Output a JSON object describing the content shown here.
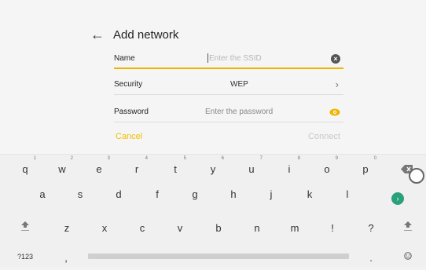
{
  "header": {
    "title": "Add network"
  },
  "form": {
    "name": {
      "label": "Name",
      "placeholder": "Enter the SSID"
    },
    "security": {
      "label": "Security",
      "value": "WEP"
    },
    "password": {
      "label": "Password",
      "placeholder": "Enter the password"
    },
    "cancel_label": "Cancel",
    "connect_label": "Connect"
  },
  "colors": {
    "accent": "#f0b400",
    "enter": "#2aa17a"
  },
  "keyboard": {
    "row1": [
      {
        "k": "q",
        "h": "1"
      },
      {
        "k": "w",
        "h": "2"
      },
      {
        "k": "e",
        "h": "3"
      },
      {
        "k": "r",
        "h": "4"
      },
      {
        "k": "t",
        "h": "5"
      },
      {
        "k": "y",
        "h": "6"
      },
      {
        "k": "u",
        "h": "7"
      },
      {
        "k": "i",
        "h": "8"
      },
      {
        "k": "o",
        "h": "9"
      },
      {
        "k": "p",
        "h": "0"
      }
    ],
    "row2": [
      "a",
      "s",
      "d",
      "f",
      "g",
      "h",
      "j",
      "k",
      "l"
    ],
    "row3": [
      "z",
      "x",
      "c",
      "v",
      "b",
      "n",
      "m",
      "!",
      "?"
    ],
    "symbols_label": "?123",
    "comma_label": ",",
    "period_label": ".",
    "icons": [
      "backspace-icon",
      "enter-icon",
      "shift-icon",
      "emoji-icon"
    ]
  }
}
